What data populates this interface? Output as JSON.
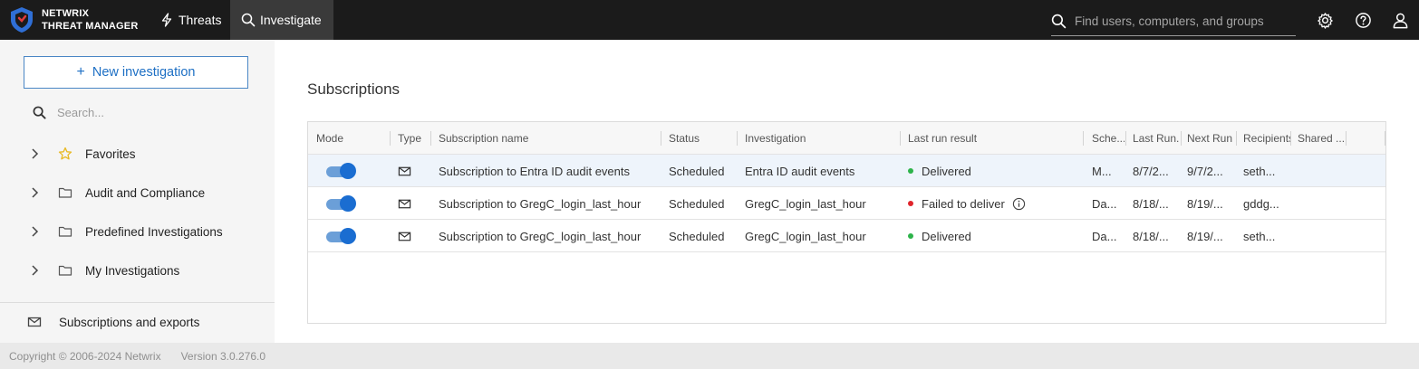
{
  "header": {
    "logo_line1": "NETWRIX",
    "logo_line2": "THREAT MANAGER",
    "nav": [
      {
        "label": "Threats",
        "icon": "bolt-icon"
      },
      {
        "label": "Investigate",
        "icon": "search-icon",
        "active": true
      }
    ],
    "search_placeholder": "Find users, computers, and groups",
    "icons": [
      "gear-icon",
      "help-icon",
      "user-icon"
    ]
  },
  "sidebar": {
    "new_button": "New investigation",
    "search_placeholder": "Search...",
    "items": [
      {
        "label": "Favorites",
        "icon": "star-icon"
      },
      {
        "label": "Audit and Compliance",
        "icon": "folder-icon"
      },
      {
        "label": "Predefined Investigations",
        "icon": "folder-icon"
      },
      {
        "label": "My Investigations",
        "icon": "folder-icon"
      }
    ],
    "bottom_item": "Subscriptions and exports"
  },
  "main": {
    "title": "Subscriptions",
    "columns": [
      "Mode",
      "Type",
      "Subscription name",
      "Status",
      "Investigation",
      "Last run result",
      "Sche...",
      "Last Run...",
      "Next Run",
      "Recipients",
      "Shared ..."
    ],
    "rows": [
      {
        "name": "Subscription to Entra ID audit events",
        "status": "Scheduled",
        "investigation": "Entra ID audit events",
        "result": "Delivered",
        "result_color": "#2db34a",
        "schedule": "M...",
        "last_run": "8/7/2...",
        "next_run": "9/7/2...",
        "recipients": "seth...",
        "selected": true,
        "info": false
      },
      {
        "name": "Subscription to GregC_login_last_hour",
        "status": "Scheduled",
        "investigation": "GregC_login_last_hour",
        "result": "Failed to deliver",
        "result_color": "#e0242b",
        "schedule": "Da...",
        "last_run": "8/18/...",
        "next_run": "8/19/...",
        "recipients": "gddg...",
        "selected": false,
        "info": true
      },
      {
        "name": "Subscription to GregC_login_last_hour",
        "status": "Scheduled",
        "investigation": "GregC_login_last_hour",
        "result": "Delivered",
        "result_color": "#2db34a",
        "schedule": "Da...",
        "last_run": "8/18/...",
        "next_run": "8/19/...",
        "recipients": "seth...",
        "selected": false,
        "info": false
      }
    ]
  },
  "footer": {
    "copyright": "Copyright © 2006-2024 Netwrix",
    "version": "Version 3.0.276.0"
  },
  "colors": {
    "accent": "#1a6dd1",
    "topbar": "#1b1b1b",
    "success": "#2db34a",
    "error": "#e0242b"
  }
}
